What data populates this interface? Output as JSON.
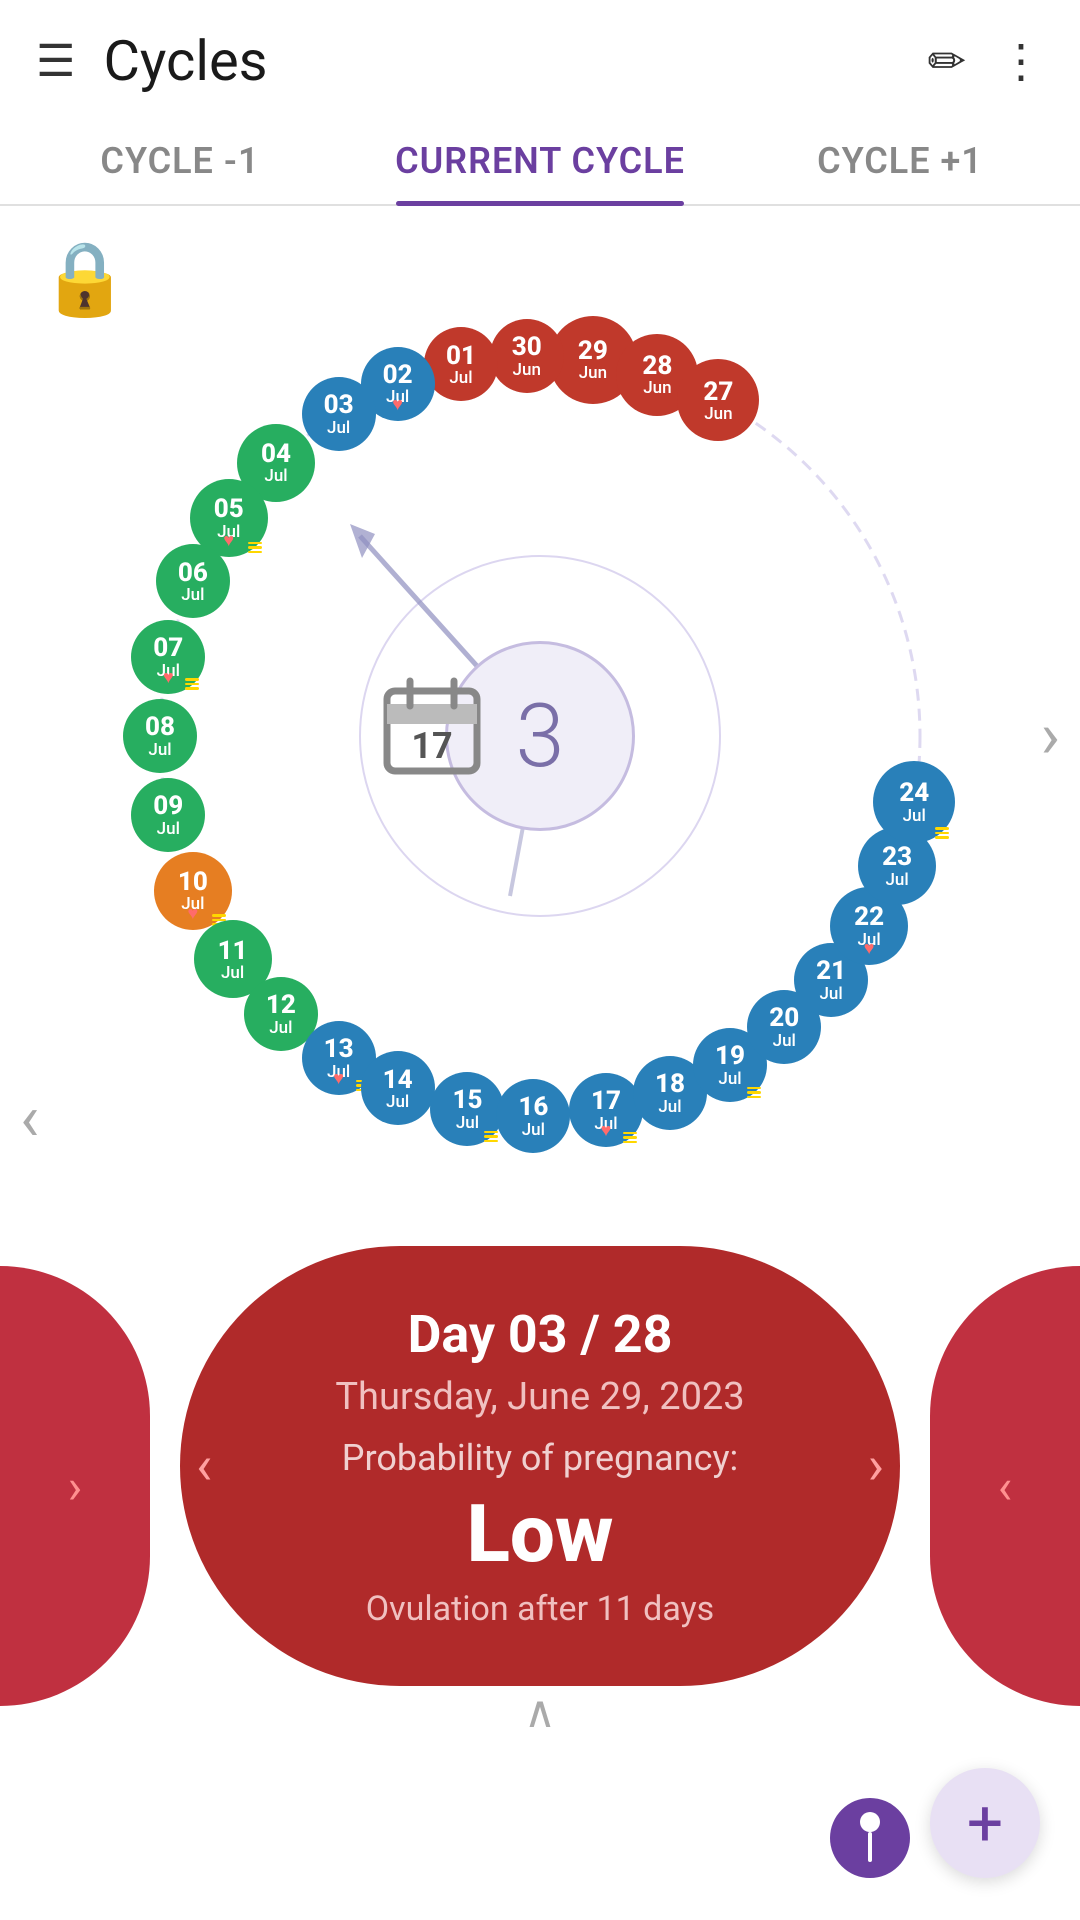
{
  "header": {
    "title": "Cycles",
    "menu_icon": "☰",
    "edit_icon": "✏",
    "more_icon": "⋮"
  },
  "tabs": [
    {
      "label": "CYCLE -1",
      "active": false
    },
    {
      "label": "CURRENT CYCLE",
      "active": true
    },
    {
      "label": "CYCLE +1",
      "active": false
    }
  ],
  "wheel": {
    "center_number": "3",
    "calendar_day": "17",
    "days": [
      {
        "num": "29",
        "month": "Jun",
        "color": "#c0392b",
        "size": 88,
        "angle": 8,
        "heart": false,
        "lines": false
      },
      {
        "num": "28",
        "month": "Jun",
        "color": "#c0392b",
        "size": 82,
        "angle": 18,
        "heart": false,
        "lines": false
      },
      {
        "num": "27",
        "month": "Jun",
        "color": "#c0392b",
        "size": 82,
        "angle": 28,
        "heart": false,
        "lines": false
      },
      {
        "num": "30",
        "month": "Jun",
        "color": "#c0392b",
        "size": 74,
        "angle": -2,
        "heart": false,
        "lines": false
      },
      {
        "num": "01",
        "month": "Jul",
        "color": "#c0392b",
        "size": 74,
        "angle": -12,
        "heart": false,
        "lines": false
      },
      {
        "num": "02",
        "month": "Jul",
        "color": "#2980b9",
        "size": 74,
        "angle": -22,
        "heart": true,
        "lines": false
      },
      {
        "num": "03",
        "month": "Jul",
        "color": "#2980b9",
        "size": 74,
        "angle": -32,
        "heart": false,
        "lines": false
      },
      {
        "num": "04",
        "month": "Jul",
        "color": "#27ae60",
        "size": 78,
        "angle": -44,
        "heart": false,
        "lines": false
      },
      {
        "num": "05",
        "month": "Jul",
        "color": "#27ae60",
        "size": 78,
        "angle": -55,
        "heart": true,
        "lines": true
      },
      {
        "num": "06",
        "month": "Jul",
        "color": "#27ae60",
        "size": 74,
        "angle": -66,
        "heart": false,
        "lines": false
      },
      {
        "num": "07",
        "month": "Jul",
        "color": "#27ae60",
        "size": 74,
        "angle": -78,
        "heart": true,
        "lines": true
      },
      {
        "num": "08",
        "month": "Jul",
        "color": "#27ae60",
        "size": 74,
        "angle": -90,
        "heart": false,
        "lines": false
      },
      {
        "num": "09",
        "month": "Jul",
        "color": "#27ae60",
        "size": 74,
        "angle": -102,
        "heart": false,
        "lines": false
      },
      {
        "num": "10",
        "month": "Jul",
        "color": "#e67e22",
        "size": 78,
        "angle": -114,
        "heart": true,
        "lines": true
      },
      {
        "num": "11",
        "month": "Jul",
        "color": "#27ae60",
        "size": 78,
        "angle": -126,
        "heart": false,
        "lines": false
      },
      {
        "num": "12",
        "month": "Jul",
        "color": "#27ae60",
        "size": 74,
        "angle": -137,
        "heart": false,
        "lines": false
      },
      {
        "num": "13",
        "month": "Jul",
        "color": "#2980b9",
        "size": 74,
        "angle": -148,
        "heart": true,
        "lines": true
      },
      {
        "num": "14",
        "month": "Jul",
        "color": "#2980b9",
        "size": 74,
        "angle": -158,
        "heart": false,
        "lines": false
      },
      {
        "num": "15",
        "month": "Jul",
        "color": "#2980b9",
        "size": 74,
        "angle": -169,
        "heart": false,
        "lines": true
      },
      {
        "num": "16",
        "month": "Jul",
        "color": "#2980b9",
        "size": 74,
        "angle": -179,
        "heart": false,
        "lines": false
      },
      {
        "num": "17",
        "month": "Jul",
        "color": "#2980b9",
        "size": 74,
        "angle": -190,
        "heart": true,
        "lines": true
      },
      {
        "num": "18",
        "month": "Jul",
        "color": "#2980b9",
        "size": 74,
        "angle": -200,
        "heart": false,
        "lines": false
      },
      {
        "num": "19",
        "month": "Jul",
        "color": "#2980b9",
        "size": 74,
        "angle": -210,
        "heart": false,
        "lines": true
      },
      {
        "num": "20",
        "month": "Jul",
        "color": "#2980b9",
        "size": 74,
        "angle": -220,
        "heart": false,
        "lines": false
      },
      {
        "num": "21",
        "month": "Jul",
        "color": "#2980b9",
        "size": 74,
        "angle": -230,
        "heart": false,
        "lines": false
      },
      {
        "num": "22",
        "month": "Jul",
        "color": "#2980b9",
        "size": 78,
        "angle": -240,
        "heart": true,
        "lines": false
      },
      {
        "num": "23",
        "month": "Jul",
        "color": "#2980b9",
        "size": 78,
        "angle": -250,
        "heart": false,
        "lines": false
      },
      {
        "num": "24",
        "month": "Jul",
        "color": "#2980b9",
        "size": 82,
        "angle": -260,
        "heart": false,
        "lines": true
      }
    ]
  },
  "info_card": {
    "day_label": "Day 03 / 28",
    "date": "Thursday, June 29, 2023",
    "prob_label": "Probability of pregnancy:",
    "prob_value": "Low",
    "ovulation_note": "Ovulation after 11 days"
  },
  "bottom": {
    "add_icon": "+"
  }
}
